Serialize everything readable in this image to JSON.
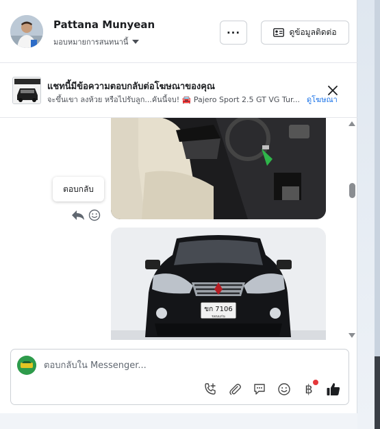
{
  "header": {
    "user_name": "Pattana Munyean",
    "assign_label": "มอบหมายการสนทนานี้",
    "more_label": "···",
    "contact_label": "ดูข้อมูลติดต่อ"
  },
  "ad_banner": {
    "title": "แชทนี้มีข้อความตอบกลับต่อโฆษณาของคุณ",
    "subtitle": "จะขึ้นเขา ลงห้วย หรือไปรับลูก...คันนี้จบ! 🚘 Pajero Sport 2.5 GT VG Tur...",
    "link_label": "ดูโฆษณา",
    "close_icon": "close-icon"
  },
  "messages": {
    "tooltip_label": "ตอบกลับ",
    "plate_line1": "ขก 7106",
    "plate_line2": "ขอนแก่น"
  },
  "composer": {
    "placeholder": "ตอบกลับใน Messenger...",
    "baht_symbol": "฿",
    "tools": [
      "call-add-icon",
      "attachment-icon",
      "saved-reply-icon",
      "emoji-icon",
      "payment-icon",
      "like-icon"
    ]
  },
  "colors": {
    "link": "#1a73e8",
    "notify_dot": "#e5383b",
    "composer_avatar": "#2e9b4b"
  }
}
